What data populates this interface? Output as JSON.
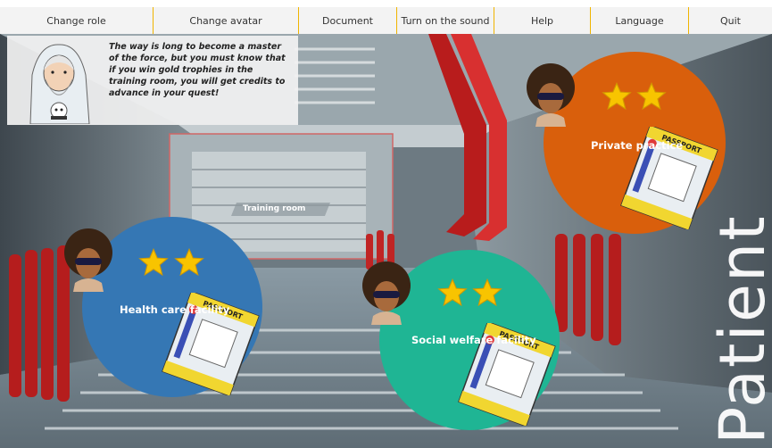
{
  "menu": {
    "items": [
      {
        "label": "Change role"
      },
      {
        "label": "Change avatar"
      },
      {
        "label": "Document"
      },
      {
        "label": "Turn on the sound"
      },
      {
        "label": "Help"
      },
      {
        "label": "Language"
      },
      {
        "label": "Quit"
      }
    ]
  },
  "mentor": {
    "message": "The way is long to become a master of the force, but you must know that if you win gold trophies in the training room, you will get credits to advance in your quest!"
  },
  "scene": {
    "training_room_label": "Training room",
    "role_label": "Patient"
  },
  "stations": {
    "health": {
      "label": "Health care facility",
      "stars": 2,
      "color": "#3577b4",
      "passport_text": "PASSPORT"
    },
    "social": {
      "label": "Social welfare facility",
      "stars": 2,
      "color": "#1fb594",
      "passport_text": "PASSPORT"
    },
    "private": {
      "label": "Private practice",
      "stars": 2,
      "color": "#d95f0c",
      "passport_text": "PASSPORT"
    }
  },
  "colors": {
    "menu_divider": "#f0b400",
    "star": "#f8c400",
    "pipe": "#c01f1f"
  }
}
